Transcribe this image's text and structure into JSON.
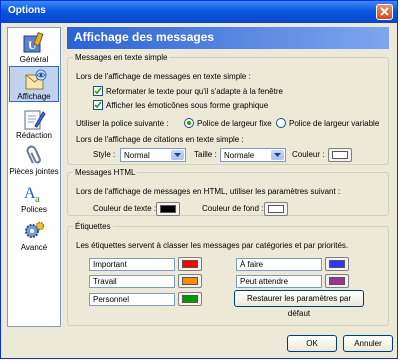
{
  "window": {
    "title": "Options"
  },
  "sidebar": {
    "items": [
      {
        "label": "Général",
        "icon": "general-icon"
      },
      {
        "label": "Affichage",
        "icon": "display-icon",
        "active": true
      },
      {
        "label": "Rédaction",
        "icon": "compose-icon"
      },
      {
        "label": "Pièces jointes",
        "icon": "paperclip-icon"
      },
      {
        "label": "Polices",
        "icon": "fonts-icon"
      },
      {
        "label": "Avancé",
        "icon": "gears-icon"
      }
    ]
  },
  "header": {
    "title": "Affichage des messages"
  },
  "plain": {
    "legend": "Messages en texte simple",
    "intro": "Lors de l'affichage de messages en texte simple :",
    "reformat": "Reformater le texte pour qu'il s'adapte à la fenêtre",
    "emoticons": "Afficher les émoticônes sous forme graphique",
    "font_label": "Utiliser la police suivante :",
    "fixed": "Police de largeur fixe",
    "variable": "Police de largeur variable",
    "quotes_intro": "Lors de l'affichage de citations en texte simple :",
    "style_label": "Style :",
    "style_value": "Normal",
    "size_label": "Taille :",
    "size_value": "Normale",
    "color_label": "Couleur :"
  },
  "html": {
    "legend": "Messages HTML",
    "intro": "Lors de l'affichage de messages en HTML, utiliser les paramètres suivant :",
    "text_color_label": "Couleur de texte :",
    "bg_color_label": "Couleur de fond :"
  },
  "labels": {
    "legend": "Étiquettes",
    "intro": "Les étiquettes servent à classer les messages par catégories et par priorités.",
    "items": [
      {
        "name": "Important",
        "color": "#ff0000"
      },
      {
        "name": "À faire",
        "color": "#3333ff"
      },
      {
        "name": "Travail",
        "color": "#ff8c00"
      },
      {
        "name": "Peut attendre",
        "color": "#993399"
      },
      {
        "name": "Personnel",
        "color": "#009900"
      }
    ],
    "restore": "Restaurer les paramètres par défaut"
  },
  "buttons": {
    "ok": "OK",
    "cancel": "Annuler"
  },
  "colors": {
    "text_color": "#000000",
    "bg_color": "#ffffff",
    "quote_color": "#ffffff"
  }
}
